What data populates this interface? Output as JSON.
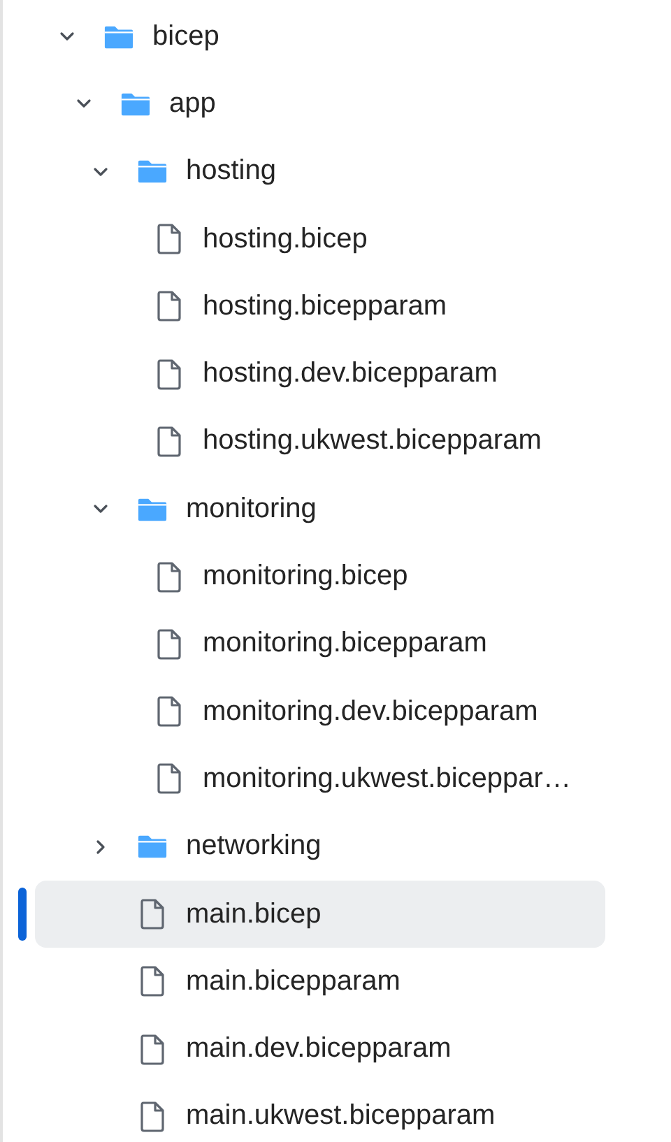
{
  "tree": [
    {
      "kind": "folder",
      "name": "bicep",
      "expanded": true,
      "selected": false,
      "children": [
        {
          "kind": "folder",
          "name": "app",
          "expanded": true,
          "selected": false,
          "children": [
            {
              "kind": "folder",
              "name": "hosting",
              "expanded": true,
              "selected": false,
              "children": [
                {
                  "kind": "file",
                  "name": "hosting.bicep",
                  "selected": false
                },
                {
                  "kind": "file",
                  "name": "hosting.bicepparam",
                  "selected": false
                },
                {
                  "kind": "file",
                  "name": "hosting.dev.bicepparam",
                  "selected": false
                },
                {
                  "kind": "file",
                  "name": "hosting.ukwest.bicepparam",
                  "selected": false
                }
              ]
            },
            {
              "kind": "folder",
              "name": "monitoring",
              "expanded": true,
              "selected": false,
              "children": [
                {
                  "kind": "file",
                  "name": "monitoring.bicep",
                  "selected": false
                },
                {
                  "kind": "file",
                  "name": "monitoring.bicepparam",
                  "selected": false
                },
                {
                  "kind": "file",
                  "name": "monitoring.dev.bicepparam",
                  "selected": false
                },
                {
                  "kind": "file",
                  "name": "monitoring.ukwest.biceppar…",
                  "selected": false
                }
              ]
            },
            {
              "kind": "folder",
              "name": "networking",
              "expanded": false,
              "selected": false
            },
            {
              "kind": "file",
              "name": "main.bicep",
              "selected": true
            },
            {
              "kind": "file",
              "name": "main.bicepparam",
              "selected": false
            },
            {
              "kind": "file",
              "name": "main.dev.bicepparam",
              "selected": false
            },
            {
              "kind": "file",
              "name": "main.ukwest.bicepparam",
              "selected": false
            }
          ]
        }
      ]
    }
  ]
}
